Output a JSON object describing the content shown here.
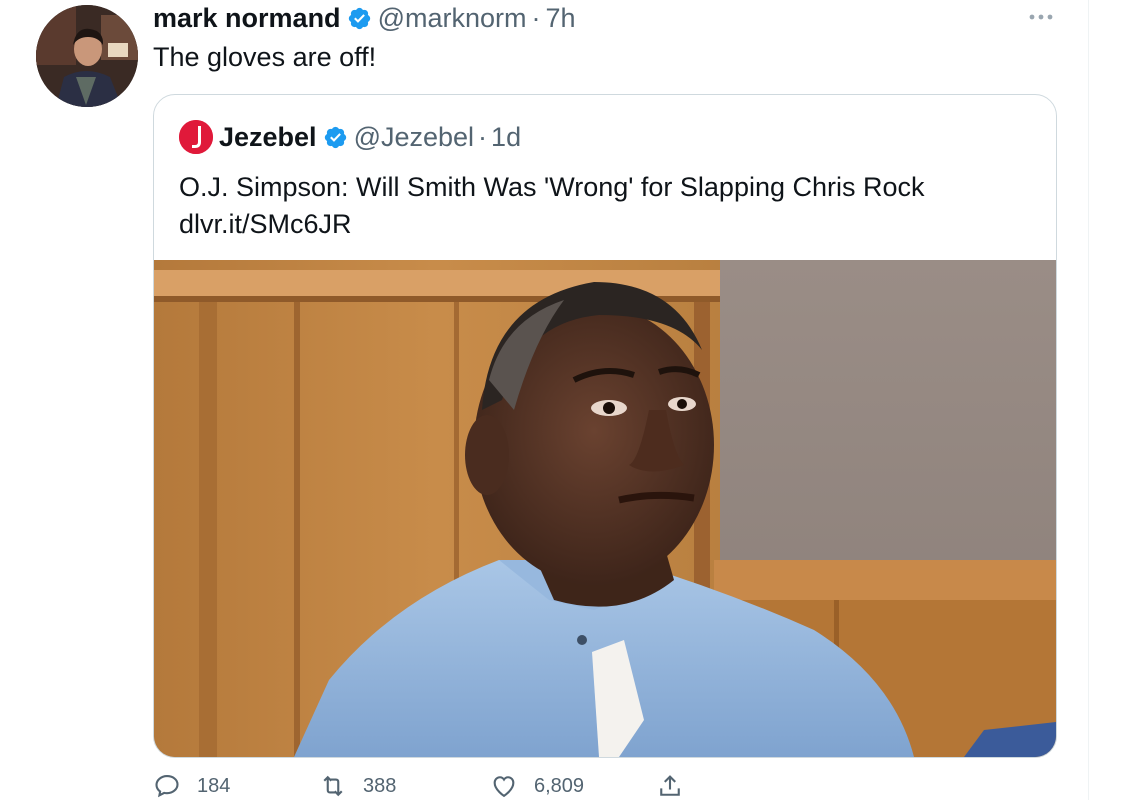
{
  "tweet": {
    "author": {
      "display_name": "mark normand",
      "handle": "@marknorm",
      "verified": true
    },
    "timestamp": "7h",
    "dot": "·",
    "text": "The gloves are off!",
    "quoted": {
      "display_name": "Jezebel",
      "handle": "@Jezebel",
      "verified": true,
      "timestamp": "1d",
      "headline": "O.J. Simpson: Will Smith Was 'Wrong' for Slapping Chris Rock",
      "link": "dlvr.it/SMc6JR",
      "logo_letter": "J"
    },
    "actions": {
      "reply_count": "184",
      "retweet_count": "388",
      "like_count": "6,809"
    }
  },
  "colors": {
    "verified": "#1d9bf0",
    "secondary_text": "#536471",
    "jezebel_brand": "#e0193a",
    "border": "#cfd9de"
  }
}
